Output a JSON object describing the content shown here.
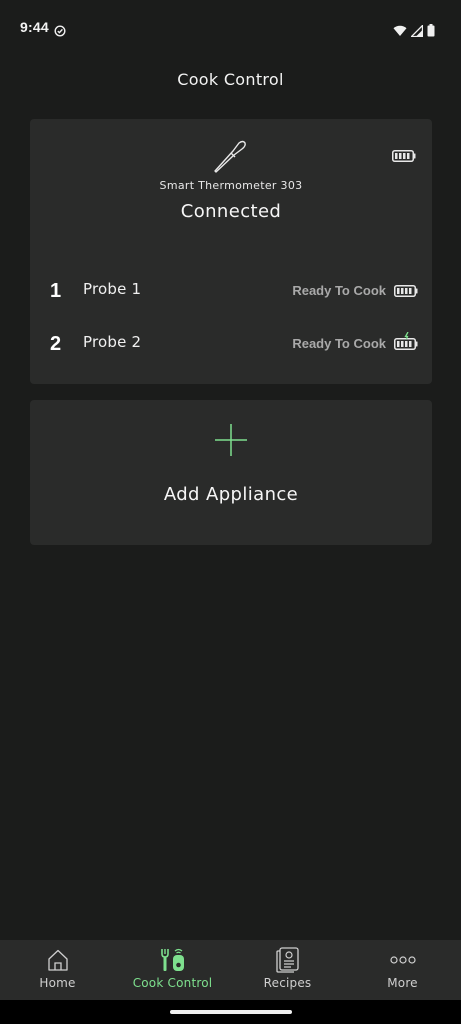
{
  "status_bar": {
    "time": "9:44",
    "icons": [
      "check-circle-icon",
      "wifi-icon",
      "signal-icon",
      "battery-icon"
    ]
  },
  "header": {
    "title": "Cook Control"
  },
  "device": {
    "name": "Smart Thermometer 303",
    "status": "Connected",
    "icon": "thermometer-probe-icon",
    "battery_icon": "battery-full-icon",
    "probes": [
      {
        "number": "1",
        "name": "Probe 1",
        "status": "Ready To Cook",
        "battery_icon": "battery-full-icon"
      },
      {
        "number": "2",
        "name": "Probe 2",
        "status": "Ready To Cook",
        "battery_icon": "battery-charging-icon"
      }
    ]
  },
  "add_appliance": {
    "label": "Add Appliance",
    "icon": "plus-icon"
  },
  "bottom_nav": {
    "items": [
      {
        "label": "Home",
        "icon": "home-icon",
        "active": false
      },
      {
        "label": "Cook Control",
        "icon": "cook-control-icon",
        "active": true
      },
      {
        "label": "Recipes",
        "icon": "recipes-icon",
        "active": false
      },
      {
        "label": "More",
        "icon": "more-icon",
        "active": false
      }
    ]
  },
  "colors": {
    "background": "#1b1c1b",
    "card": "#2a2b2a",
    "accent": "#7ee08e",
    "muted_text": "#a9a9a9"
  }
}
